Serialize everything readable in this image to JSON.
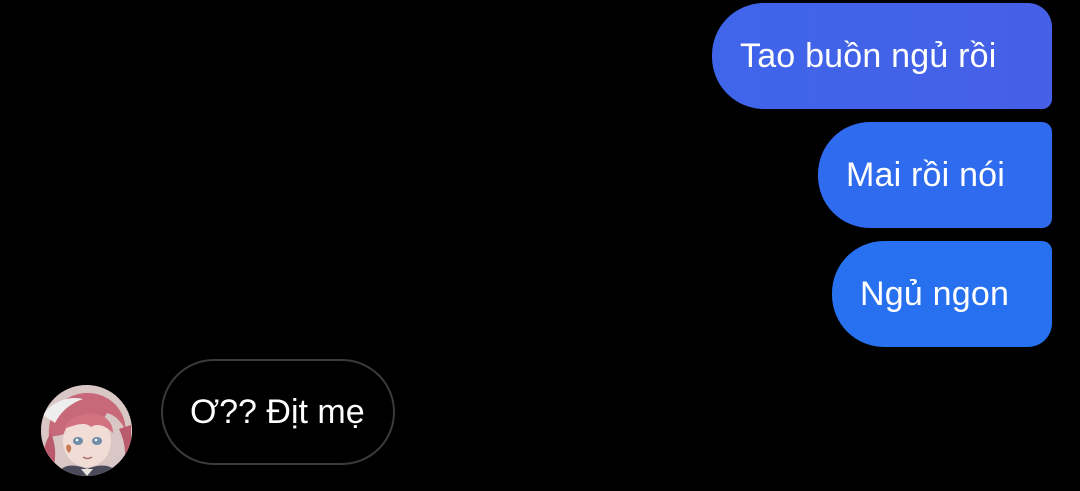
{
  "conversation": {
    "outgoing": [
      {
        "text": "Tao buồn ngủ rồi"
      },
      {
        "text": "Mai rồi nói"
      },
      {
        "text": "Ngủ ngon"
      }
    ],
    "incoming": [
      {
        "text": "Ơ?? Địt mẹ",
        "avatar_icon": "anime-character-avatar-icon"
      }
    ]
  },
  "colors": {
    "background": "#000000",
    "outgoing_bubble_top": "#4360e8",
    "outgoing_bubble_bottom": "#2771f0",
    "incoming_bubble_border": "#3a3a3a",
    "text": "#ffffff"
  }
}
